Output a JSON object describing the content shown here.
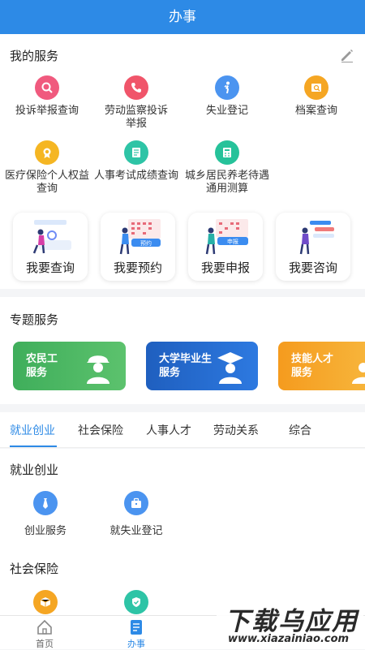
{
  "header": {
    "title": "办事"
  },
  "my_services": {
    "title": "我的服务",
    "items": [
      {
        "label": "投诉举报查询",
        "icon": "search-icon",
        "color": "#f05a7e"
      },
      {
        "label": "劳动监察投诉举报",
        "icon": "phone-icon",
        "color": "#f0556a"
      },
      {
        "label": "失业登记",
        "icon": "person-walking-icon",
        "color": "#4b94f0"
      },
      {
        "label": "档案查询",
        "icon": "folder-search-icon",
        "color": "#f5a623"
      },
      {
        "label": "医疗保险个人权益查询",
        "icon": "medal-icon",
        "color": "#f5b623"
      },
      {
        "label": "人事考试成绩查询",
        "icon": "document-icon",
        "color": "#2ec4a6"
      },
      {
        "label": "城乡居民养老待遇通用测算",
        "icon": "calculator-icon",
        "color": "#26c29a"
      }
    ]
  },
  "quick_actions": [
    {
      "label": "我要查询",
      "illu_text": ""
    },
    {
      "label": "我要预约",
      "illu_text": "预约"
    },
    {
      "label": "我要申报",
      "illu_text": "申报"
    },
    {
      "label": "我要咨询",
      "illu_text": ""
    }
  ],
  "topics": {
    "title": "专题服务",
    "items": [
      {
        "label_line1": "农民工",
        "label_line2": "服务",
        "color": "#3fae5b"
      },
      {
        "label_line1": "大学毕业生",
        "label_line2": "服务",
        "color": "#1f5fbf"
      },
      {
        "label_line1": "技能人才",
        "label_line2": "服务",
        "color": "#f59b1e"
      }
    ]
  },
  "tabs": [
    "就业创业",
    "社会保险",
    "人事人才",
    "劳动关系",
    "综合"
  ],
  "active_tab": "就业创业",
  "employment": {
    "title": "就业创业",
    "items": [
      {
        "label": "创业服务",
        "color": "#4b94f0"
      },
      {
        "label": "就失业登记",
        "color": "#4b94f0"
      }
    ]
  },
  "social_insurance": {
    "title": "社会保险",
    "items": [
      {
        "label": "",
        "color": "#f5a623"
      },
      {
        "label": "",
        "color": "#2ec4a6"
      }
    ]
  },
  "bottom_nav": [
    {
      "label": "首页",
      "icon": "home-icon"
    },
    {
      "label": "办事",
      "icon": "task-icon"
    }
  ],
  "watermark": {
    "line1": "下载乌应用",
    "line2": "www.xiazainiao.com"
  }
}
